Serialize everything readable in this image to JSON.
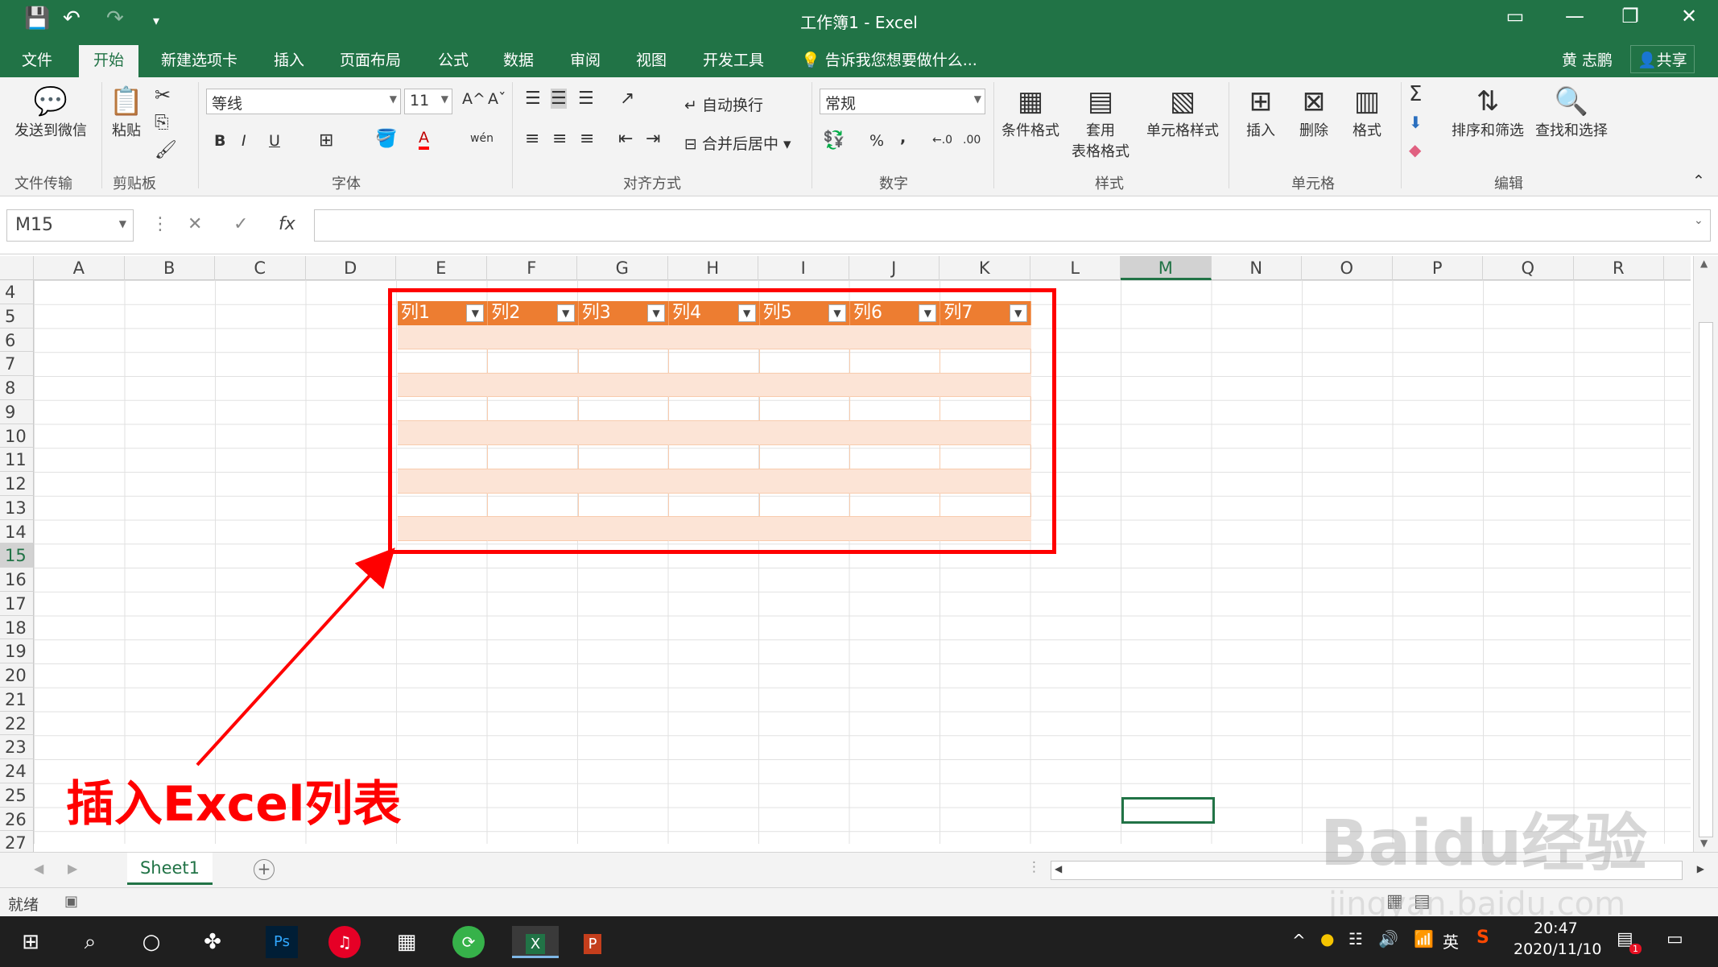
{
  "titlebar": {
    "title": "工作簿1 - Excel",
    "save_icon": "💾",
    "undo_icon": "↶",
    "redo_icon": "↷",
    "customize_icon": "▾",
    "ribbon_options_icon": "▭",
    "minimize_icon": "—",
    "restore_icon": "❐",
    "close_icon": "✕"
  },
  "tabs": [
    "文件",
    "开始",
    "新建选项卡",
    "插入",
    "页面布局",
    "公式",
    "数据",
    "审阅",
    "视图",
    "开发工具"
  ],
  "tell_me": "告诉我您想要做什么...",
  "user": "黄 志鹏",
  "share": "共享",
  "ribbon": {
    "send_wechat": "发送到微信",
    "group_transfer": "文件传输",
    "paste": "粘贴",
    "group_clipboard": "剪贴板",
    "font_name": "等线",
    "font_size": "11",
    "group_font": "字体",
    "bold": "B",
    "italic": "I",
    "underline": "U",
    "grow_font": "A^",
    "shrink_font": "Aˇ",
    "font_color": "A",
    "wen": "wén",
    "wrap_text": "自动换行",
    "merge_center": "合并后居中",
    "group_align": "对齐方式",
    "number_format": "常规",
    "percent": "%",
    "comma": ",",
    "inc_decimal": "←.0",
    "dec_decimal": ".00",
    "group_number": "数字",
    "conditional_format": "条件格式",
    "table_format_1": "套用",
    "table_format_2": "表格格式",
    "cell_styles": "单元格样式",
    "group_styles": "样式",
    "insert": "插入",
    "delete": "删除",
    "format": "格式",
    "group_cells": "单元格",
    "sort_filter": "排序和筛选",
    "find_select": "查找和选择",
    "group_edit": "编辑",
    "sum_icon": "Σ",
    "fill_icon": "⬇",
    "clear_icon": "◆"
  },
  "formula_bar": {
    "name_box": "M15",
    "cancel": "✕",
    "enter": "✓",
    "fx": "fx",
    "content": ""
  },
  "columns": [
    "A",
    "B",
    "C",
    "D",
    "E",
    "F",
    "G",
    "H",
    "I",
    "J",
    "K",
    "L",
    "M",
    "N",
    "O",
    "P",
    "Q",
    "R"
  ],
  "selected_column": "M",
  "rows": [
    "4",
    "5",
    "6",
    "7",
    "8",
    "9",
    "10",
    "11",
    "12",
    "13",
    "14",
    "15",
    "16",
    "17",
    "18",
    "19",
    "20",
    "21",
    "22",
    "23",
    "24",
    "25",
    "26",
    "27"
  ],
  "selected_row": "15",
  "table": {
    "headers": [
      "列1",
      "列2",
      "列3",
      "列4",
      "列5",
      "列6",
      "列7"
    ],
    "filter_icon": "▼"
  },
  "annotation": "插入Excel列表",
  "sheet": {
    "tab": "Sheet1",
    "add": "+"
  },
  "status": {
    "ready": "就绪"
  },
  "taskbar": {
    "time": "20:47",
    "date": "2020/11/10",
    "ime": "英",
    "notification_count": "1"
  },
  "watermark": "Baidu经验",
  "watermark_url": "jingyan.baidu.com",
  "colors": {
    "excel_green": "#217346",
    "table_header": "#ed7d31",
    "table_band": "#fce4d6",
    "annotation_red": "#ff0000"
  }
}
